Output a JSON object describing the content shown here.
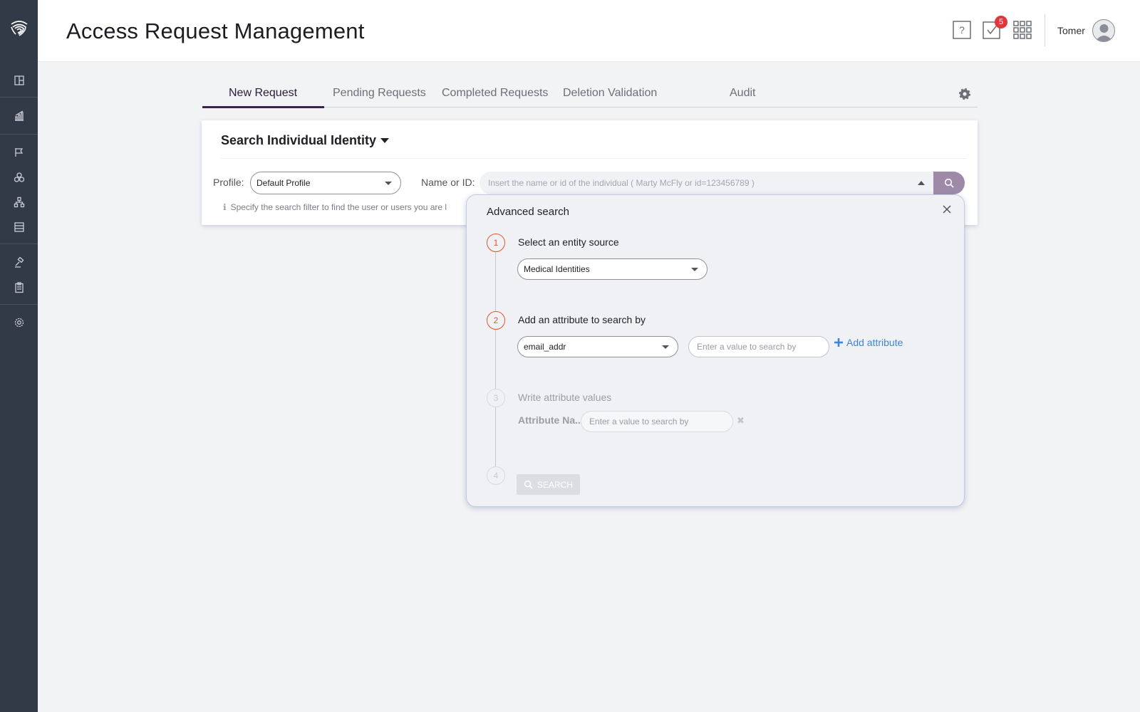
{
  "sidebar": {
    "items": [
      {
        "name": "dashboard-icon"
      },
      {
        "name": "analytics-icon"
      },
      {
        "name": "flag-icon"
      },
      {
        "name": "circles-icon"
      },
      {
        "name": "hierarchy-icon"
      },
      {
        "name": "database-icon"
      },
      {
        "name": "gavel-icon"
      },
      {
        "name": "clipboard-icon"
      },
      {
        "name": "settings-icon"
      }
    ]
  },
  "header": {
    "title": "Access Request Management",
    "notifications_count": "5",
    "user_name": "Tomer"
  },
  "tabs": [
    {
      "label": "New Request"
    },
    {
      "label": "Pending Requests"
    },
    {
      "label": "Completed Requests"
    },
    {
      "label": "Deletion Validation"
    },
    {
      "label": "Audit"
    }
  ],
  "search_card": {
    "title": "Search Individual Identity",
    "profile_label": "Profile:",
    "profile_value": "Default Profile",
    "name_label": "Name or ID:",
    "name_placeholder": "Insert the name or id of the individual ( Marty McFly or id=123456789 )",
    "hint": "Specify the search filter to find the user or users you are l"
  },
  "advanced_search": {
    "title": "Advanced search",
    "steps": [
      {
        "number": "1",
        "title": "Select an entity source",
        "value": "Medical Identities"
      },
      {
        "number": "2",
        "title": "Add an attribute to search by",
        "value": "email_addr",
        "placeholder": "Enter a value to search by",
        "add_label": "Add attribute"
      },
      {
        "number": "3",
        "title": "Write attribute values",
        "attribute_name": "Attribute Na...",
        "placeholder": "Enter a value to search by"
      },
      {
        "number": "4",
        "button_label": "SEARCH"
      }
    ]
  },
  "colors": {
    "sidebar_bg": "#333a47",
    "accent_purple": "#3f1f4e",
    "search_btn": "#9e8aa8",
    "step_active": "#e0572e",
    "link_blue": "#3d86d8",
    "badge_red": "#e2353c"
  }
}
